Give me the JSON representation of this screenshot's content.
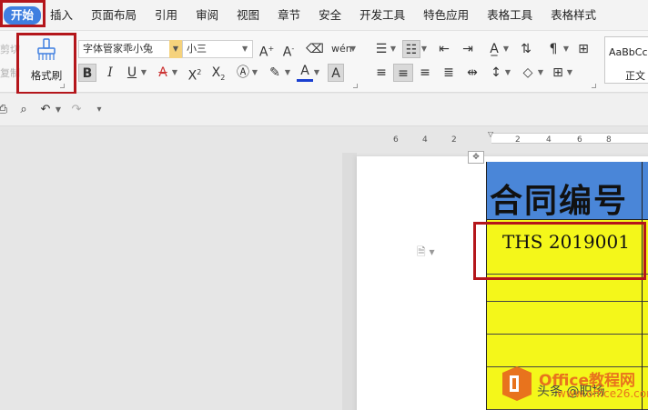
{
  "menu": {
    "items": [
      "开始",
      "插入",
      "页面布局",
      "引用",
      "审阅",
      "视图",
      "章节",
      "安全",
      "开发工具",
      "特色应用",
      "表格工具",
      "表格样式"
    ]
  },
  "clipboard": {
    "cut_label": "剪切",
    "copy_label": "复制",
    "format_painter_label": "格式刷"
  },
  "font": {
    "name": "字体管家乖小兔",
    "size": "小三"
  },
  "styles": {
    "sample": "AaBbCc",
    "name": "正文"
  },
  "ruler": {
    "ticks": [
      "6",
      "4",
      "2",
      "2",
      "4",
      "6",
      "8"
    ]
  },
  "table": {
    "header": "合同编号",
    "value": "THS 2019001"
  },
  "watermark": {
    "brand": "Office教程网",
    "url": "www.office26.com",
    "author": "头条 @职场"
  },
  "colors": {
    "accent": "#3f7fe0",
    "highlight": "#b4161b",
    "table_header": "#4a86d8",
    "table_fill": "#f4f71a"
  }
}
